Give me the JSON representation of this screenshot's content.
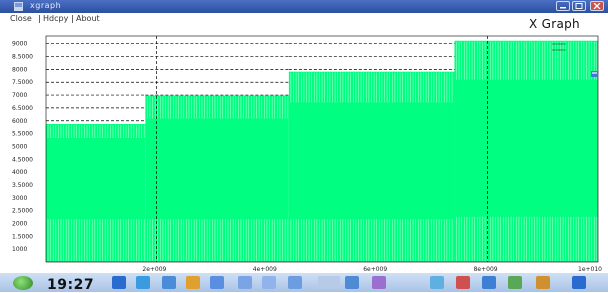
{
  "window": {
    "title": "xgraph",
    "menu": [
      "Close",
      "Hdcpy",
      "About"
    ]
  },
  "header": {
    "app_label": "X Graph"
  },
  "taskbar": {
    "clock": "19:27"
  },
  "colors": {
    "fill": "#00ff80",
    "bar_line": "#e6fff0",
    "dashed": "#000000",
    "titlebar": "#2c4f9e",
    "taskbar": "#b9d0ee"
  },
  "icons": [
    "window-icon",
    "minimize-icon",
    "maximize-icon",
    "close-icon",
    "start-orb-icon",
    "taskbar-app-icons"
  ],
  "chart_data": {
    "type": "area",
    "plot": "stepped",
    "y_ticks": [
      "1000",
      "1.5000",
      "2000",
      "2.5000",
      "3000",
      "3.5000",
      "4000",
      "4.5000",
      "5000",
      "5.5000",
      "6000",
      "6.5000",
      "7000",
      "7.5000",
      "8000",
      "8.5000",
      "9000"
    ],
    "x_ticks": [
      "2e+009",
      "4e+009",
      "6e+009",
      "8e+009",
      "1e+010"
    ],
    "xlim": [
      0,
      10000000000
    ],
    "ylim": [
      0,
      9500
    ],
    "grid": {
      "vertical_dashed_at": [
        2000000000,
        8000000000
      ],
      "horizontal_dashed": true
    },
    "series": [
      {
        "steps": [
          {
            "x0": 0,
            "x1": 1800000000,
            "lower": 1800,
            "upper": 5800
          },
          {
            "x0": 1800000000,
            "x1": 4400000000,
            "lower": 1800,
            "upper": 7000
          },
          {
            "x0": 4400000000,
            "x1": 7400000000,
            "lower": 1800,
            "upper": 8000
          },
          {
            "x0": 7400000000,
            "x1": 10000000000,
            "lower": 1900,
            "upper": 9300
          }
        ]
      }
    ],
    "legend": {
      "placement": "top-right",
      "entries": [
        "",
        ""
      ]
    }
  }
}
